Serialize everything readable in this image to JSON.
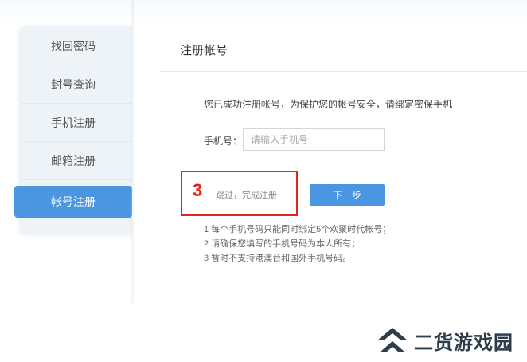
{
  "sidebar": {
    "items": [
      {
        "label": "找回密码",
        "active": false
      },
      {
        "label": "封号查询",
        "active": false
      },
      {
        "label": "手机注册",
        "active": false
      },
      {
        "label": "邮箱注册",
        "active": false
      },
      {
        "label": "帐号注册",
        "active": true
      }
    ]
  },
  "main": {
    "title": "注册帐号",
    "notice": "您已成功注册帐号，为保护您的帐号安全，请绑定密保手机",
    "phone_label": "手机号：",
    "phone_value": "",
    "phone_placeholder": "请输入手机号",
    "step_number": "3",
    "skip_label": "跳过，完成注册",
    "next_label": "下一步",
    "tips": [
      "1 每个手机号码只能同时绑定5个欢聚时代帐号；",
      "2 请确保您填写的手机号码为本人所有；",
      "3 暂时不支持港澳台和国外手机号码。"
    ]
  },
  "watermark": {
    "text": "二货游戏园",
    "icon": "double-chevron-up-icon"
  },
  "colors": {
    "accent": "#4b96e0",
    "highlight_red": "#e2231a",
    "sidebar_bg": "#eef3f8"
  }
}
